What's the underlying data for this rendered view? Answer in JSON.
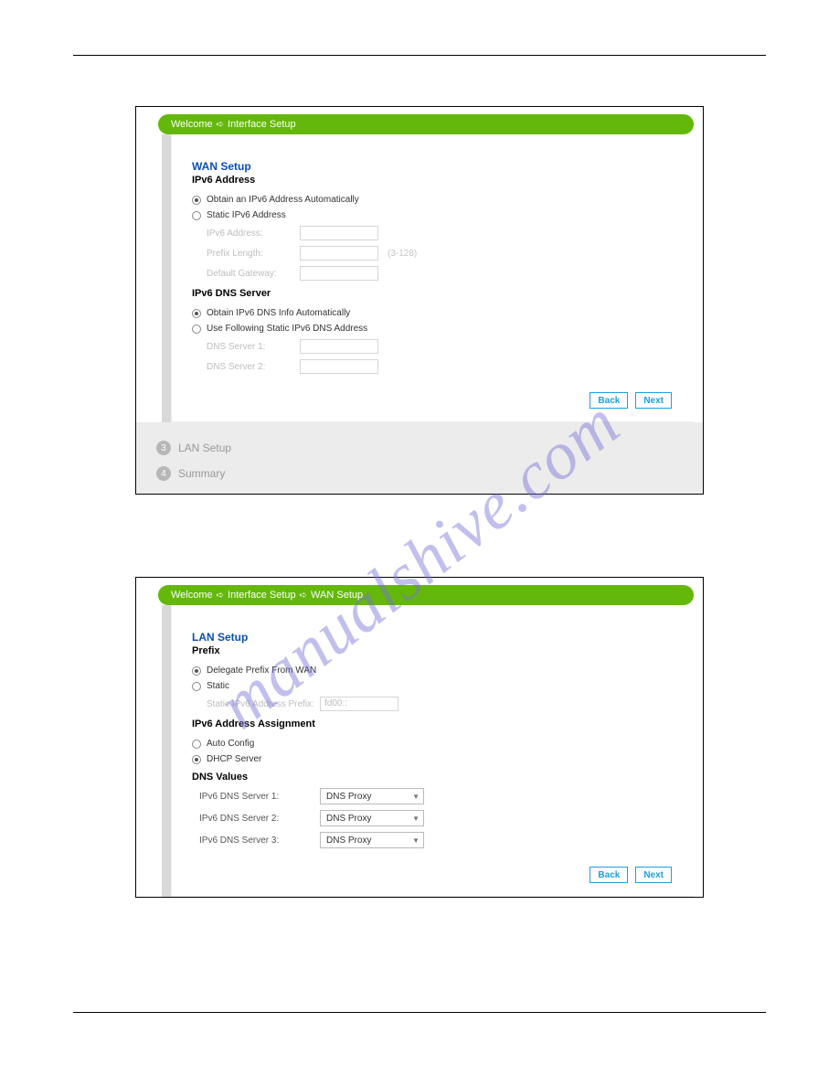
{
  "watermark": "manualshive.com",
  "screenshot1": {
    "breadcrumb": [
      "Welcome",
      "Interface Setup"
    ],
    "title": "WAN Setup",
    "subtitle": "IPv6 Address",
    "radio1": "Obtain an IPv6 Address Automatically",
    "radio2": "Static IPv6 Address",
    "field_ipv6addr": "IPv6 Address:",
    "field_prefixlen": "Prefix Length:",
    "field_prefixlen_hint": "(3-128)",
    "field_gateway": "Default Gateway:",
    "section2": "IPv6 DNS Server",
    "radio3": "Obtain IPv6 DNS Info Automatically",
    "radio4": "Use Following Static IPv6 DNS Address",
    "field_dns1": "DNS Server 1:",
    "field_dns2": "DNS Server 2:",
    "btn_back": "Back",
    "btn_next": "Next",
    "step3_num": "3",
    "step3": "LAN Setup",
    "step4_num": "4",
    "step4": "Summary"
  },
  "screenshot2": {
    "breadcrumb": [
      "Welcome",
      "Interface Setup",
      "WAN Setup"
    ],
    "title": "LAN Setup",
    "subtitle": "Prefix",
    "radio1": "Delegate Prefix From WAN",
    "radio2": "Static",
    "field_staticprefix": "Static IPv6 Address Prefix:",
    "field_staticprefix_val": "fd00::",
    "section2": "IPv6 Address Assignment",
    "radio3": "Auto Config",
    "radio4": "DHCP Server",
    "section3": "DNS Values",
    "field_dns1": "IPv6 DNS Server 1:",
    "field_dns2": "IPv6 DNS Server 2:",
    "field_dns3": "IPv6 DNS Server 3:",
    "dns_val": "DNS Proxy",
    "btn_back": "Back",
    "btn_next": "Next"
  }
}
